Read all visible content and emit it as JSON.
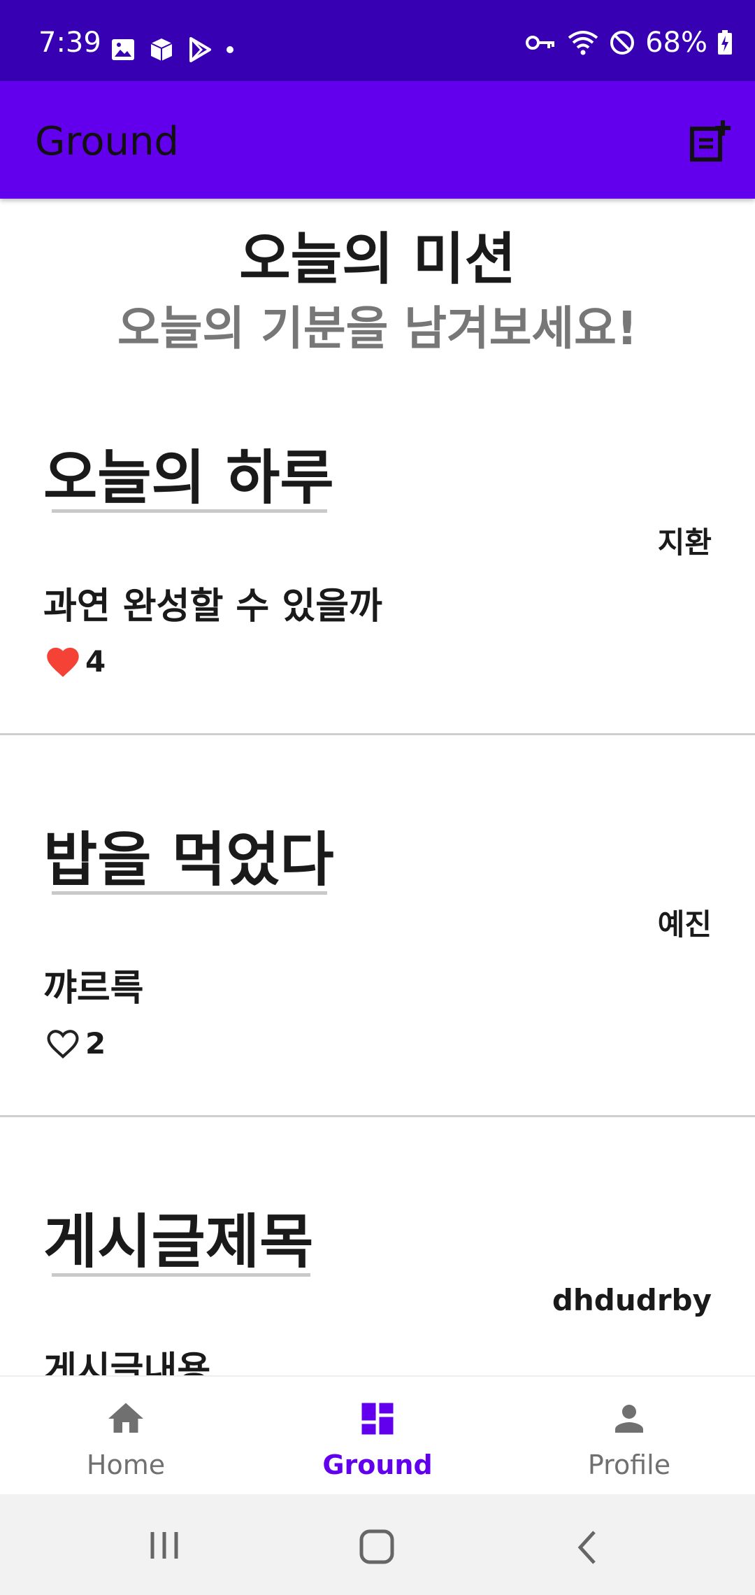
{
  "status_bar": {
    "time": "7:39",
    "battery": "68%"
  },
  "app_bar": {
    "title": "Ground",
    "icon": "add-post-icon"
  },
  "mission": {
    "title": "오늘의 미션",
    "subtitle": "오늘의 기분을 남겨보세요!"
  },
  "posts": [
    {
      "title": "오늘의 하루",
      "author": "지환",
      "body": "과연 완성할 수 있을까",
      "likes": "4",
      "liked": true
    },
    {
      "title": "밥을 먹었다",
      "author": "예진",
      "body": "꺄르륵",
      "likes": "2",
      "liked": false
    },
    {
      "title": "게시글제목",
      "author": "dhdudrby",
      "body": "게시글내용"
    }
  ],
  "bottom_nav": {
    "items": [
      {
        "label": "Home",
        "icon": "home-icon"
      },
      {
        "label": "Ground",
        "icon": "dashboard-icon",
        "active": true
      },
      {
        "label": "Profile",
        "icon": "person-icon"
      }
    ]
  },
  "colors": {
    "status_bar": "#3700B3",
    "app_bar": "#6200EE",
    "accent": "#6200EE",
    "like_red": "#F44336"
  }
}
